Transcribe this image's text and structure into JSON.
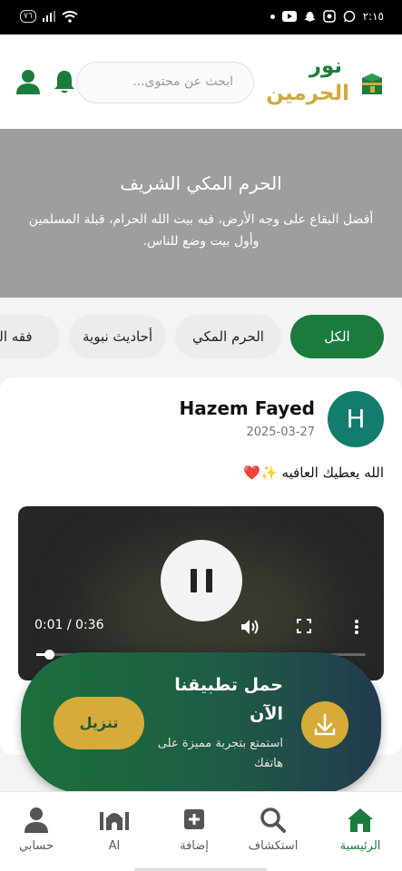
{
  "status_bar": {
    "time": "٢:١٥",
    "battery": "٧٦"
  },
  "header": {
    "logo_line1": "نور",
    "logo_line2": "الحرمين",
    "search_placeholder": "ابحث عن محتوى..."
  },
  "banner": {
    "title": "الحرم المكي الشريف",
    "description": "أفضل البقاع على وجه الأرض، فيه بيت الله الحرام، قبلة المسلمين وأول بيت وضع للناس."
  },
  "categories": [
    {
      "label": "الكل",
      "active": true
    },
    {
      "label": "الحرم المكي",
      "active": false
    },
    {
      "label": "أحاديث نبوية",
      "active": false
    },
    {
      "label": "فقه العبادات",
      "active": false
    }
  ],
  "post": {
    "avatar_letter": "H",
    "author": "Hazem Fayed",
    "date": "2025-03-27",
    "text": "الله يعطيك العافيه ✨❤️",
    "video": {
      "time": "0:01 / 0:36",
      "progress": 0.03
    }
  },
  "download_popup": {
    "title": "حمل تطبيقنا الآن",
    "subtitle": "استمتع بتجربة مميزة على هاتفك",
    "button_label": "تنزيل"
  },
  "bottom_nav": [
    {
      "label": "الرئيسية",
      "icon": "home-icon",
      "active": true
    },
    {
      "label": "استكشاف",
      "icon": "search-icon",
      "active": false
    },
    {
      "label": "إضافة",
      "icon": "plus-square-icon",
      "active": false
    },
    {
      "label": "AI",
      "icon": "mosque-icon",
      "active": false
    },
    {
      "label": "حسابي",
      "icon": "person-icon",
      "active": false
    }
  ],
  "colors": {
    "primary": "#1c7a3c",
    "gold": "#d6ab3a",
    "avatar": "#127d6c"
  }
}
